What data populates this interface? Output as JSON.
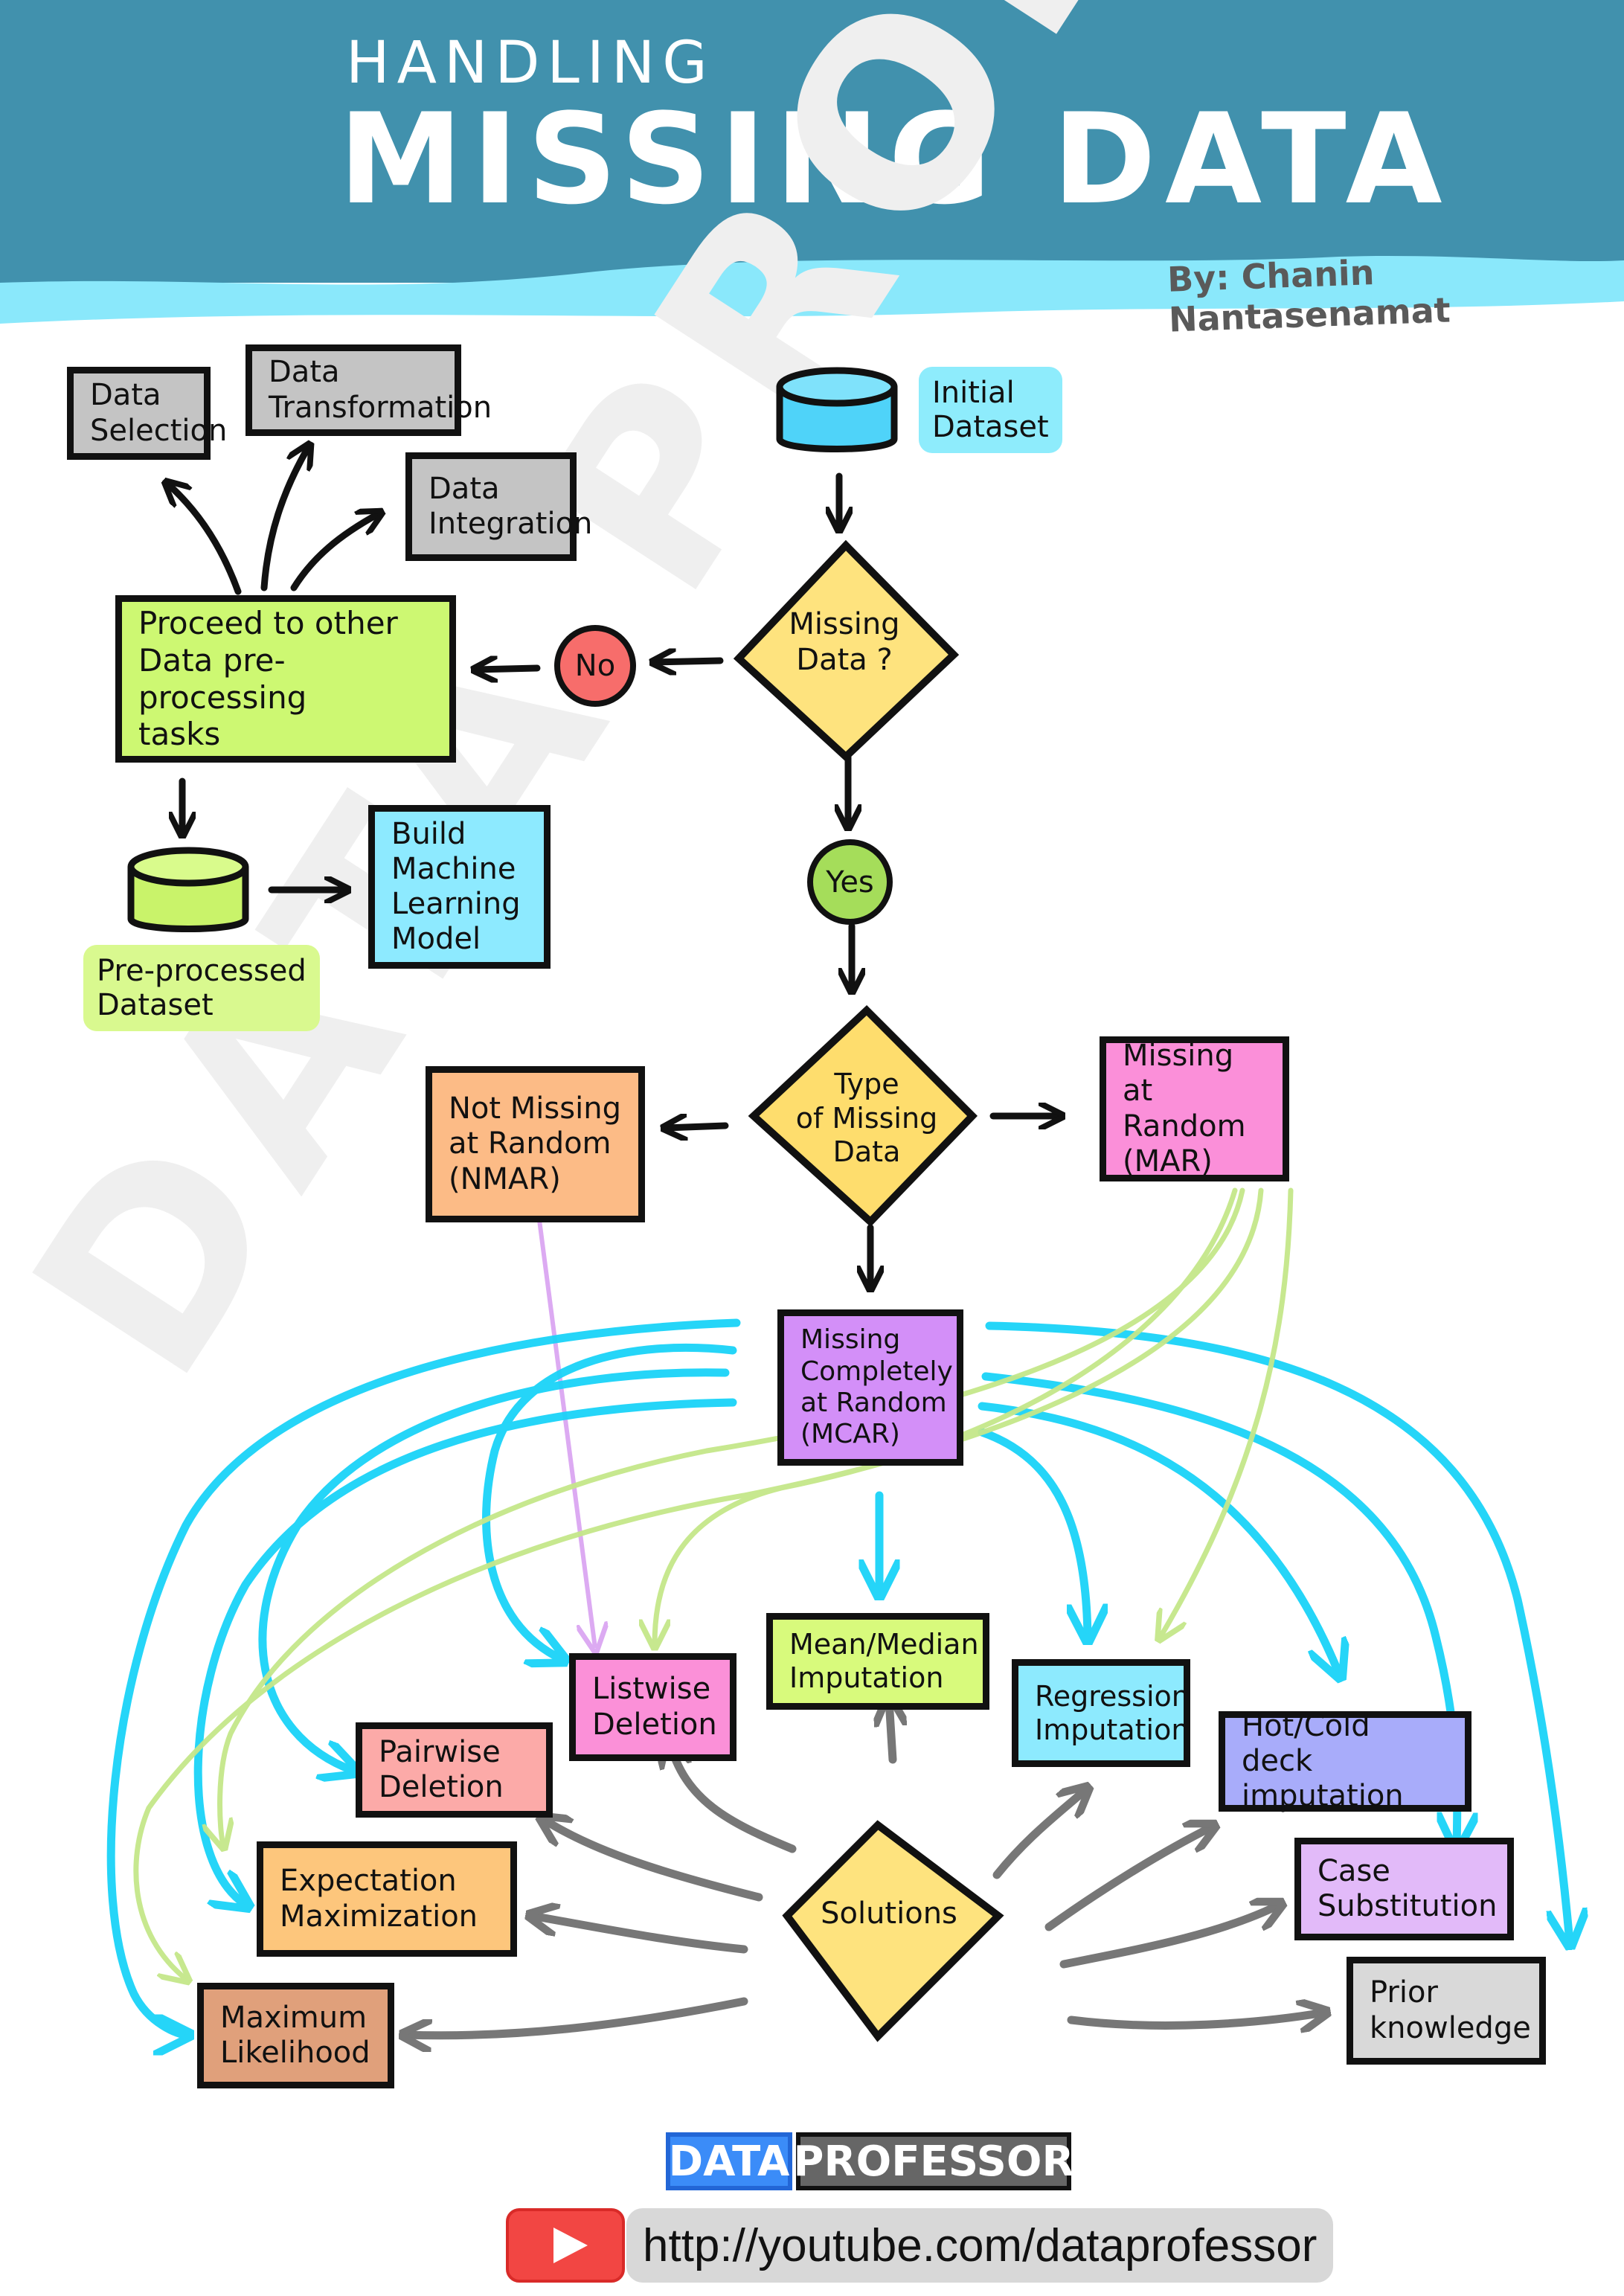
{
  "header": {
    "title_line1": "HANDLING",
    "title_line2": "MISSING DATA",
    "byline": "By: Chanin Nantasenamat",
    "banner_color": "#4191ad",
    "wave_color": "#8ae8fb"
  },
  "watermark": "DATA PROFESSOR",
  "preprocessing": {
    "other_tasks": [
      "Data\nSelection",
      "Data\nTransformation",
      "Data\nIntegration"
    ],
    "proceed_box": "Proceed to other\nData pre-processing\ntasks",
    "preprocessed_dataset_label": "Pre-processed\nDataset",
    "build_model_box": "Build\nMachine\nLearning\nModel"
  },
  "decision_flow": {
    "initial_dataset_label": "Initial\nDataset",
    "missing_data_decision": "Missing\nData ?",
    "no_label": "No",
    "yes_label": "Yes",
    "type_decision": "Type\nof Missing\nData"
  },
  "missing_types": {
    "nmar": "Not Missing\nat Random\n(NMAR)",
    "mar": "Missing\nat Random\n(MAR)",
    "mcar": "Missing\nCompletely\nat Random\n(MCAR)"
  },
  "solutions": {
    "hub_label": "Solutions",
    "items": {
      "listwise": "Listwise\nDeletion",
      "pairwise": "Pairwise\nDeletion",
      "mean_median": "Mean/Median\nImputation",
      "regression": "Regression\nImputation",
      "hot_cold": "Hot/Cold deck\nimputation",
      "em": "Expectation\nMaximization",
      "case_sub": "Case\nSubstitution",
      "ml": "Maximum\nLikelihood",
      "prior": "Prior\nknowledge"
    }
  },
  "edge_colors": {
    "mcar": "#1ad3f8",
    "mar": "#c5e78a",
    "nmar": "#dcaaf2",
    "solutions": "#777777",
    "main": "#111111"
  },
  "footer": {
    "logo_left": "DATA",
    "logo_right": "PROFESSOR",
    "url": "http://youtube.com/dataprofessor"
  }
}
